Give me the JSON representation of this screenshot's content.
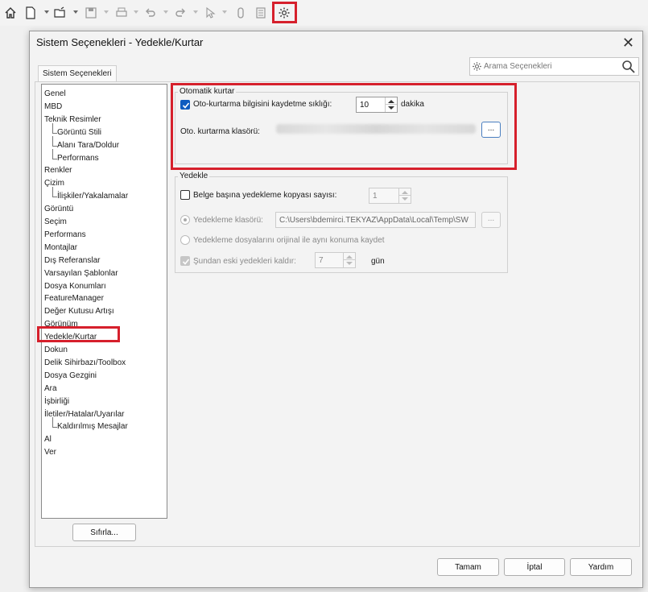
{
  "toolbar": {
    "icons": [
      "home-icon",
      "new-file-icon",
      "open-folder-icon",
      "save-icon",
      "print-icon",
      "undo-icon",
      "redo-icon",
      "select-icon",
      "attach-icon",
      "file-properties-icon",
      "options-gear-icon"
    ]
  },
  "dialog": {
    "title": "Sistem Seçenekleri - Yedekle/Kurtar",
    "close_label": "✕"
  },
  "tab": {
    "label": "Sistem Seçenekleri"
  },
  "search": {
    "placeholder": "Arama Seçenekleri"
  },
  "tree": {
    "items": [
      {
        "label": "Genel"
      },
      {
        "label": "MBD"
      },
      {
        "label": "Teknik Resimler"
      },
      {
        "label": "Görüntü Stili",
        "child": true
      },
      {
        "label": "Alanı Tara/Doldur",
        "child": true
      },
      {
        "label": "Performans",
        "child": true
      },
      {
        "label": "Renkler"
      },
      {
        "label": "Çizim"
      },
      {
        "label": "İlişkiler/Yakalamalar",
        "child": true
      },
      {
        "label": "Görüntü"
      },
      {
        "label": "Seçim"
      },
      {
        "label": "Performans"
      },
      {
        "label": "Montajlar"
      },
      {
        "label": "Dış Referanslar"
      },
      {
        "label": "Varsayılan Şablonlar"
      },
      {
        "label": "Dosya Konumları"
      },
      {
        "label": "FeatureManager"
      },
      {
        "label": "Değer Kutusu Artışı"
      },
      {
        "label": "Görünüm"
      },
      {
        "label": "Yedekle/Kurtar",
        "selected": true
      },
      {
        "label": "Dokun"
      },
      {
        "label": "Delik Sihirbazı/Toolbox"
      },
      {
        "label": "Dosya Gezgini"
      },
      {
        "label": "Ara"
      },
      {
        "label": "İşbirliği"
      },
      {
        "label": "İletiler/Hatalar/Uyarılar"
      },
      {
        "label": "Kaldırılmış Mesajlar",
        "child": true
      },
      {
        "label": "Al"
      },
      {
        "label": "Ver"
      }
    ],
    "reset_label": "Sıfırla..."
  },
  "autorecover": {
    "group_label": "Otomatik kurtar",
    "save_interval_label": "Oto-kurtarma bilgisini kaydetme sıklığı:",
    "save_interval_checked": true,
    "interval_value": "10",
    "interval_unit": "dakika",
    "folder_label": "Oto. kurtarma klasörü:",
    "browse_label": "..."
  },
  "backup": {
    "group_label": "Yedekle",
    "copies_label": "Belge başına yedekleme kopyası sayısı:",
    "copies_checked": false,
    "copies_value": "1",
    "folder_radio_label": "Yedekleme klasörü:",
    "folder_path": "C:\\Users\\bdemirci.TEKYAZ\\AppData\\Local\\Temp\\SW",
    "browse_label": "...",
    "same_location_label": "Yedekleme dosyalarını orijinal ile aynı konuma kaydet",
    "delete_older_label": "Şundan eski yedekleri kaldır:",
    "delete_older_value": "7",
    "delete_older_unit": "gün"
  },
  "footer": {
    "ok_label": "Tamam",
    "cancel_label": "İptal",
    "help_label": "Yardım"
  },
  "highlight_color": "#d6202c"
}
